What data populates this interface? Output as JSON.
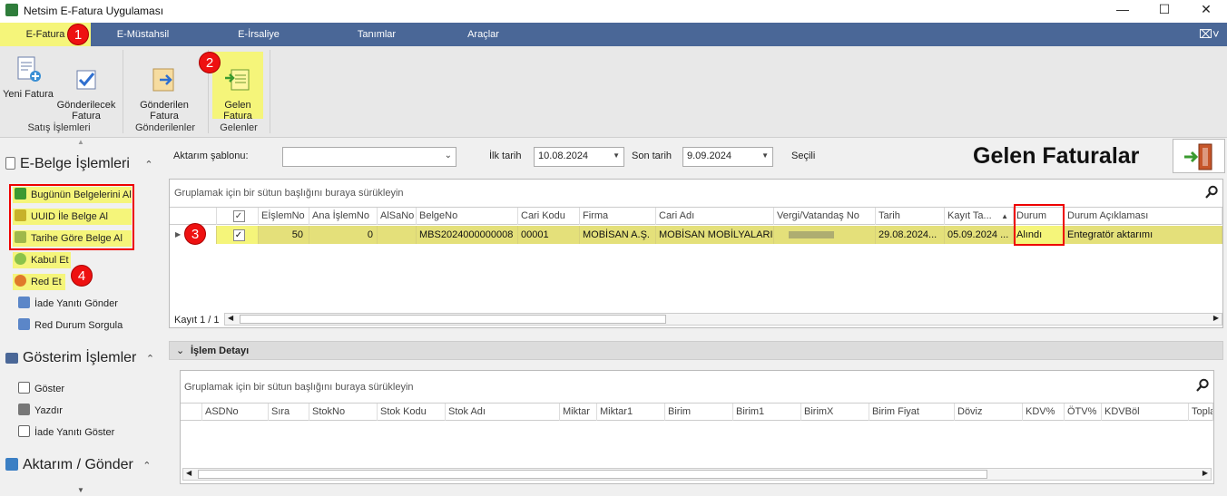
{
  "window": {
    "title": "Netsim E-Fatura Uygulaması"
  },
  "ribbon_tabs": [
    "E-Fatura",
    "E-Müstahsil",
    "E-İrsaliye",
    "Tanımlar",
    "Araçlar"
  ],
  "ribbon": {
    "buttons": [
      {
        "label": "Yeni Fatura",
        "icon": "new-invoice-icon"
      },
      {
        "label": "Gönderilecek\nFatura",
        "icon": "checkmark-icon"
      },
      {
        "label": "Gönderilen\nFatura",
        "icon": "sent-document-icon"
      },
      {
        "label": "Gelen\nFatura",
        "icon": "incoming-document-icon"
      }
    ],
    "groups": [
      "Satış İşlemleri",
      "Gönderilenler",
      "Gelenler"
    ]
  },
  "markers": [
    "1",
    "2",
    "3",
    "4"
  ],
  "sidebar": {
    "sections": [
      "E-Belge İşlemleri",
      "Gösterim İşlemler",
      "Aktarım / Gönder"
    ],
    "ebelge_items": [
      "Bugünün Belgelerini Al",
      "UUID İle Belge Al",
      "Tarihe Göre Belge Al",
      "Kabul Et",
      "Red Et",
      "İade Yanıtı Gönder",
      "Red Durum Sorgula"
    ],
    "gosterim_items": [
      "Göster",
      "Yazdır",
      "İade Yanıtı Göster"
    ]
  },
  "filters": {
    "aktarim_label": "Aktarım şablonu:",
    "aktarim_value": "",
    "ilk_tarih_label": "İlk tarih",
    "ilk_tarih_value": "10.08.2024",
    "son_tarih_label": "Son tarih",
    "son_tarih_value": "9.09.2024",
    "secili_label": "Seçili"
  },
  "page_title": "Gelen Faturalar",
  "grid1": {
    "group_hint": "Gruplamak için bir sütun başlığını buraya sürükleyin",
    "columns": [
      "EİşlemNo",
      "Ana İşlemNo",
      "AlSaNo",
      "BelgeNo",
      "Cari Kodu",
      "Firma",
      "Cari Adı",
      "Vergi/Vatandaş No",
      "Tarih",
      "Kayıt Ta...",
      "Durum",
      "Durum Açıklaması"
    ],
    "row": [
      "50",
      "0",
      "",
      "MBS2024000000008",
      "00001",
      "MOBİSAN A.Ş.",
      "MOBİSAN MOBİLYALARI",
      "",
      "29.08.2024...",
      "05.09.2024 ...",
      "Alındı",
      "Entegratör aktarımı"
    ],
    "record_text": "Kayıt 1 / 1"
  },
  "detail": {
    "title": "İşlem Detayı",
    "group_hint": "Gruplamak için bir sütun başlığını buraya sürükleyin",
    "columns": [
      "ASDNo",
      "Sıra",
      "StokNo",
      "Stok Kodu",
      "Stok Adı",
      "Miktar",
      "Miktar1",
      "Birim",
      "Birim1",
      "BirimX",
      "Birim Fiyat",
      "Döviz",
      "KDV%",
      "ÖTV%",
      "KDVBöl",
      "Topla"
    ]
  },
  "colors": {
    "ribbon_tab": "#4a6797",
    "highlight": "#f5f57a",
    "marker": "#e11111",
    "selected_row": "#e4e07a"
  }
}
